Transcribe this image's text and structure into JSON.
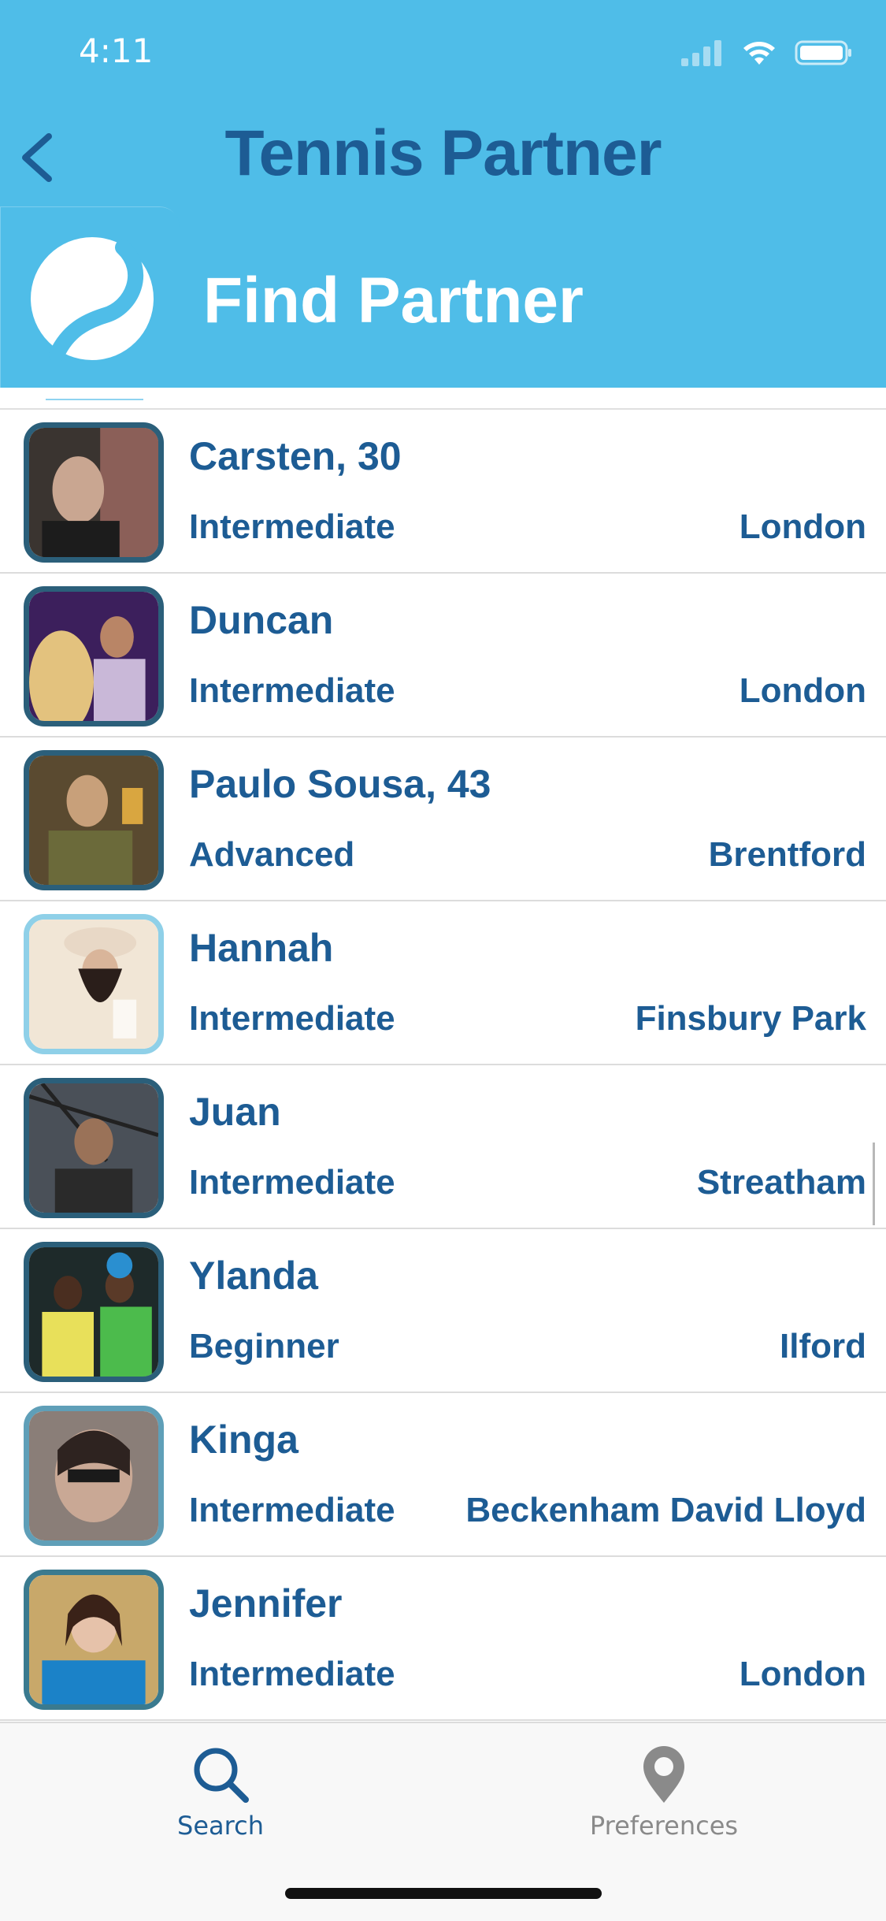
{
  "status_bar": {
    "time": "4:11"
  },
  "nav": {
    "title": "Tennis Partner"
  },
  "hero": {
    "title": "Find Partner"
  },
  "players": [
    {
      "name": "Carsten, 30",
      "level": "Intermediate",
      "location": "London"
    },
    {
      "name": "Duncan",
      "level": "Intermediate",
      "location": "London"
    },
    {
      "name": "Paulo Sousa, 43",
      "level": "Advanced",
      "location": "Brentford"
    },
    {
      "name": "Hannah",
      "level": "Intermediate",
      "location": "Finsbury Park"
    },
    {
      "name": "Juan",
      "level": "Intermediate",
      "location": "Streatham"
    },
    {
      "name": "Ylanda",
      "level": "Beginner",
      "location": "Ilford"
    },
    {
      "name": "Kinga",
      "level": "Intermediate",
      "location": "Beckenham David Lloyd"
    },
    {
      "name": "Jennifer",
      "level": "Intermediate",
      "location": "London"
    }
  ],
  "tabbar": {
    "search_label": "Search",
    "preferences_label": "Preferences"
  },
  "colors": {
    "header_blue": "#4fbde8",
    "text_blue": "#1d5c94",
    "active_tab": "#1d5c94",
    "inactive_tab": "#8a8a8a"
  }
}
